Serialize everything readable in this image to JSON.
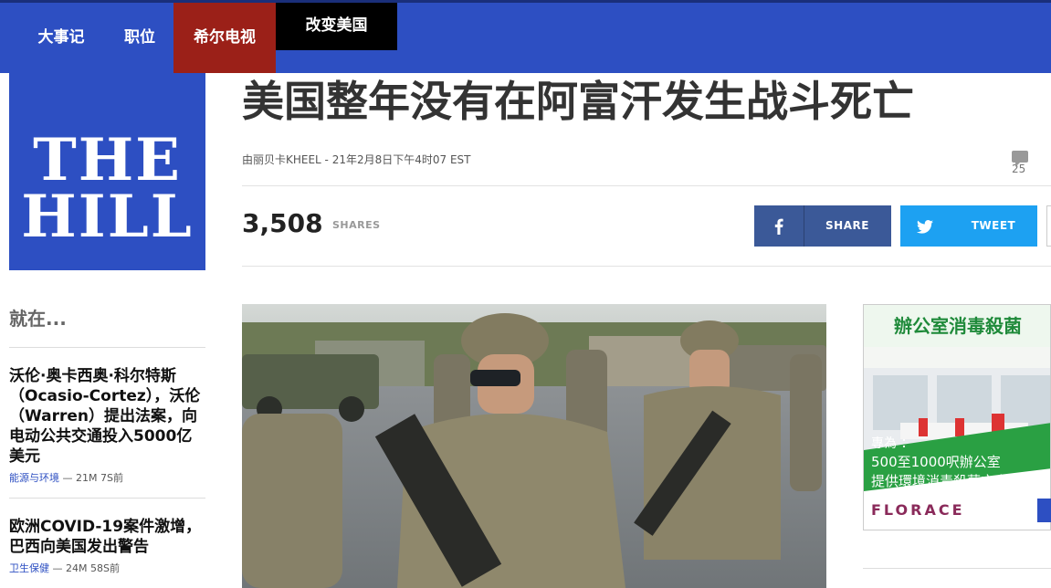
{
  "nav": {
    "items": [
      {
        "label": "大事记"
      },
      {
        "label": "职位"
      },
      {
        "label": "希尔电视"
      },
      {
        "label": "改变美国"
      }
    ],
    "colors": {
      "bar": "#2d4fc2",
      "active": "#9b2018",
      "dark": "#000000"
    }
  },
  "logo": {
    "line1": "THE",
    "line2": "HILL"
  },
  "rail": {
    "title": "就在...",
    "items": [
      {
        "headline": "沃伦·奥卡西奥·科尔特斯（Ocasio-Cortez），沃伦（Warren）提出法案，向电动公共交通投入5000亿美元",
        "category": "能源与环境",
        "time": "— 21M 7S前"
      },
      {
        "headline": "欧洲COVID-19案件激增，巴西向美国发出警告",
        "category": "卫生保健",
        "time": "— 24M 58S前"
      }
    ]
  },
  "article": {
    "headline": "美国整年没有在阿富汗发生战斗死亡",
    "byline": "由丽贝卡KHEEL - 21年2月8日下午4时07 EST",
    "comments": "25"
  },
  "share": {
    "count": "3,508",
    "label": "SHARES",
    "facebook": {
      "icon": "facebook-icon",
      "label": "SHARE",
      "color": "#3b5998"
    },
    "twitter": {
      "icon": "twitter-icon",
      "label": "TWEET",
      "color": "#1da1f2"
    }
  },
  "ad": {
    "title": "辦公室消毒殺菌",
    "line1": "專為 ：",
    "line2": "500至1000呎辦公室",
    "line3": "提供環境消毒殺菌方案",
    "brand": "FLORACE"
  }
}
